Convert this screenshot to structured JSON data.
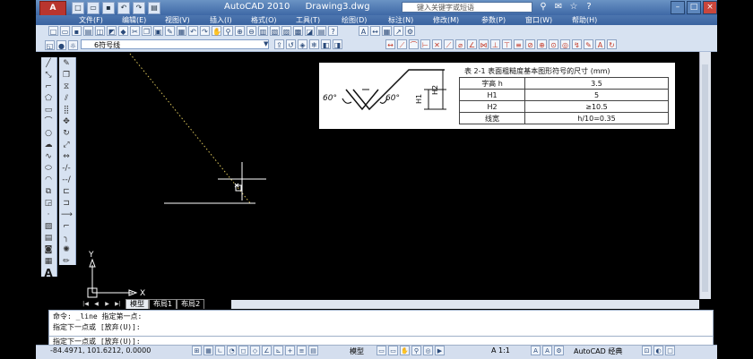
{
  "app": {
    "logo": "A",
    "title": "AutoCAD 2010",
    "document": "Drawing3.dwg",
    "search_placeholder": "键入关键字或短语"
  },
  "menu": [
    "文件(F)",
    "编辑(E)",
    "视图(V)",
    "插入(I)",
    "格式(O)",
    "工具(T)",
    "绘图(D)",
    "标注(N)",
    "修改(M)",
    "参数(P)",
    "窗口(W)",
    "帮助(H)"
  ],
  "layer": {
    "current": "6符号线"
  },
  "reference": {
    "title": "表 2-1  表面粗糙度基本图形符号的尺寸 (mm)",
    "angle_left": "60°",
    "angle_right": "60°",
    "dim_h1": "H1",
    "dim_h2": "H2",
    "rows": [
      {
        "label": "字高 h",
        "value": "3.5"
      },
      {
        "label": "H1",
        "value": "5"
      },
      {
        "label": "H2",
        "value": "≥10.5"
      },
      {
        "label": "线宽",
        "value": "h/10=0.35"
      }
    ]
  },
  "ucs": {
    "x": "X",
    "y": "Y"
  },
  "tabs": [
    "模型",
    "布局1",
    "布局2"
  ],
  "command": {
    "line1": "命令:  _line 指定第一点:",
    "line2": "指定下一点或 [放弃(U)]:",
    "prompt": "指定下一点或 [放弃(U)]:"
  },
  "status": {
    "coords": "-84.4971,  101.6212, 0.0000",
    "model": "模型",
    "scale": "A 1:1",
    "workspace": "AutoCAD 经典"
  }
}
